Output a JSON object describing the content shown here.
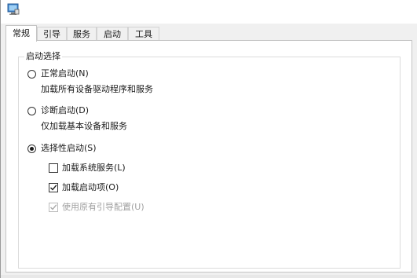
{
  "tabs": [
    {
      "label": "常规",
      "active": true
    },
    {
      "label": "引导",
      "active": false
    },
    {
      "label": "服务",
      "active": false
    },
    {
      "label": "启动",
      "active": false
    },
    {
      "label": "工具",
      "active": false
    }
  ],
  "startup_selection": {
    "title": "启动选择",
    "normal": {
      "label": "正常启动(N)",
      "description": "加载所有设备驱动程序和服务",
      "selected": false
    },
    "diagnostic": {
      "label": "诊断启动(D)",
      "description": "仅加载基本设备和服务",
      "selected": false
    },
    "selective": {
      "label": "选择性启动(S)",
      "selected": true,
      "options": {
        "load_system_services": {
          "label": "加载系统服务(L)",
          "checked": false,
          "enabled": true
        },
        "load_startup_items": {
          "label": "加载启动项(O)",
          "checked": true,
          "enabled": true
        },
        "use_original_boot_config": {
          "label": "使用原有引导配置(U)",
          "checked": true,
          "enabled": false
        }
      }
    }
  },
  "colors": {
    "window_bg": "#f0f0f0",
    "panel_bg": "#ffffff",
    "border": "#c4c4c4",
    "disabled_text": "#a0a0a0"
  },
  "icons": {
    "app": "msconfig-app-icon"
  }
}
